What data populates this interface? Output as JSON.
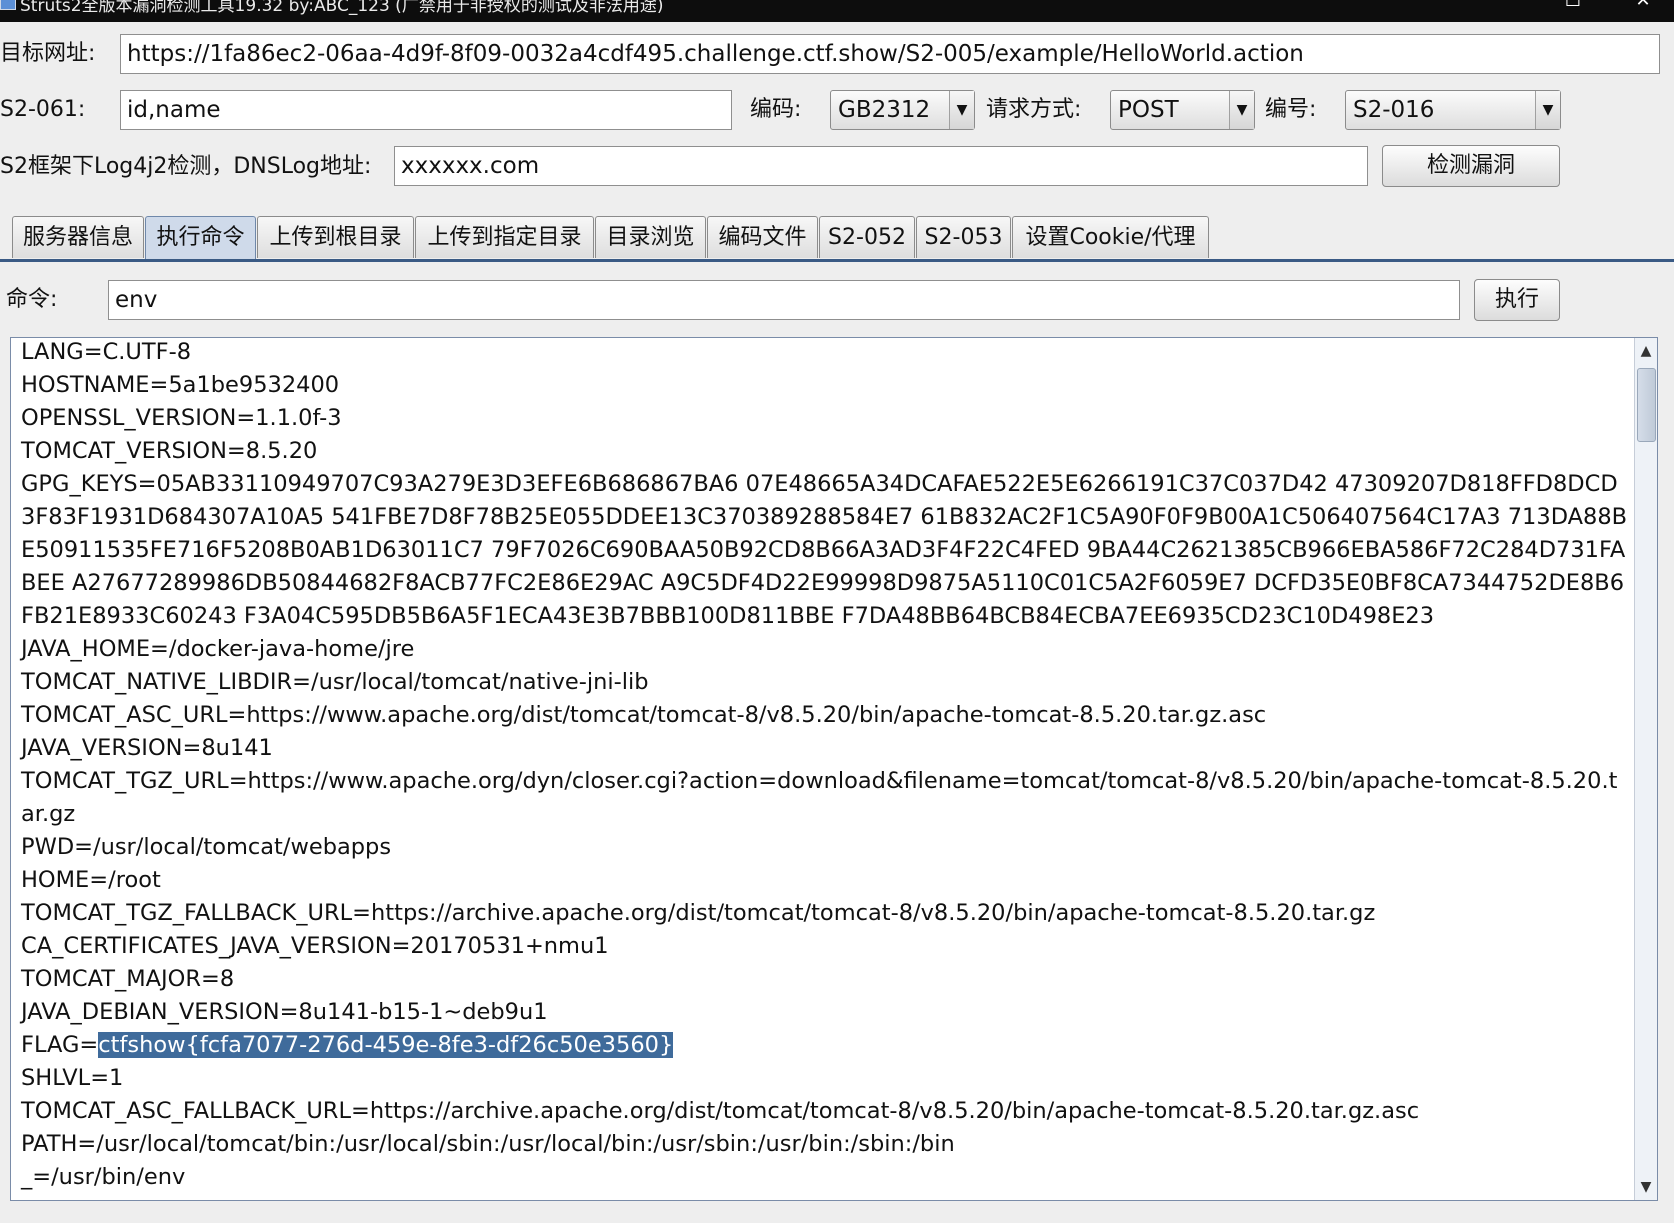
{
  "window": {
    "title": "Struts2全版本漏洞检测工具19.32 by:ABC_123 (广禁用于非授权的测试及非法用途)",
    "maximize_glyph": "☐",
    "close_glyph": "✕"
  },
  "form": {
    "url_label": "目标网址:",
    "url_value": "https://1fa86ec2-06aa-4d9f-8f09-0032a4cdf495.challenge.ctf.show/S2-005/example/HelloWorld.action",
    "s2061_label": "S2-061:",
    "s2061_value": "id,name",
    "encoding_label": "编码:",
    "encoding_value": "GB2312",
    "method_label": "请求方式:",
    "method_value": "POST",
    "vuln_label": "编号:",
    "vuln_value": "S2-016",
    "log4j_label": "S2框架下Log4j2检测，DNSLog地址:",
    "dnslog_value": "xxxxxx.com",
    "detect_button": "检测漏洞",
    "dropdown_arrow": "▼"
  },
  "tabs": [
    {
      "label": "服务器信息"
    },
    {
      "label": "执行命令"
    },
    {
      "label": "上传到根目录"
    },
    {
      "label": "上传到指定目录"
    },
    {
      "label": "目录浏览"
    },
    {
      "label": "编码文件"
    },
    {
      "label": "S2-052"
    },
    {
      "label": "S2-053"
    },
    {
      "label": "设置Cookie/代理"
    }
  ],
  "active_tab_index": 1,
  "command": {
    "label": "命令:",
    "value": "env",
    "execute_button": "执行"
  },
  "output": {
    "before_highlight": "LANG=C.UTF-8\nHOSTNAME=5a1be9532400\nOPENSSL_VERSION=1.1.0f-3\nTOMCAT_VERSION=8.5.20\nGPG_KEYS=05AB33110949707C93A279E3D3EFE6B686867BA6 07E48665A34DCAFAE522E5E6266191C37C037D42 47309207D818FFD8DCD3F83F1931D684307A10A5 541FBE7D8F78B25E055DDEE13C370389288584E7 61B832AC2F1C5A90F0F9B00A1C506407564C17A3 713DA88BE50911535FE716F5208B0AB1D63011C7 79F7026C690BAA50B92CD8B66A3AD3F4F22C4FED 9BA44C2621385CB966EBA586F72C284D731FABEE A27677289986DB50844682F8ACB77FC2E86E29AC A9C5DF4D22E99998D9875A5110C01C5A2F6059E7 DCFD35E0BF8CA7344752DE8B6FB21E8933C60243 F3A04C595DB5B6A5F1ECA43E3B7BBB100D811BBE F7DA48BB64BCB84ECBA7EE6935CD23C10D498E23\nJAVA_HOME=/docker-java-home/jre\nTOMCAT_NATIVE_LIBDIR=/usr/local/tomcat/native-jni-lib\nTOMCAT_ASC_URL=https://www.apache.org/dist/tomcat/tomcat-8/v8.5.20/bin/apache-tomcat-8.5.20.tar.gz.asc\nJAVA_VERSION=8u141\nTOMCAT_TGZ_URL=https://www.apache.org/dyn/closer.cgi?action=download&filename=tomcat/tomcat-8/v8.5.20/bin/apache-tomcat-8.5.20.tar.gz\nPWD=/usr/local/tomcat/webapps\nHOME=/root\nTOMCAT_TGZ_FALLBACK_URL=https://archive.apache.org/dist/tomcat/tomcat-8/v8.5.20/bin/apache-tomcat-8.5.20.tar.gz\nCA_CERTIFICATES_JAVA_VERSION=20170531+nmu1\nTOMCAT_MAJOR=8\nJAVA_DEBIAN_VERSION=8u141-b15-1~deb9u1\nFLAG=",
    "highlighted": "ctfshow{fcfa7077-276d-459e-8fe3-df26c50e3560}",
    "after_highlight": "\nSHLVL=1\nTOMCAT_ASC_FALLBACK_URL=https://archive.apache.org/dist/tomcat/tomcat-8/v8.5.20/bin/apache-tomcat-8.5.20.tar.gz.asc\nPATH=/usr/local/tomcat/bin:/usr/local/sbin:/usr/local/bin:/usr/sbin:/usr/bin:/sbin:/bin\n_=/usr/bin/env"
  },
  "scrollbar": {
    "up_glyph": "▲",
    "down_glyph": "▼"
  }
}
